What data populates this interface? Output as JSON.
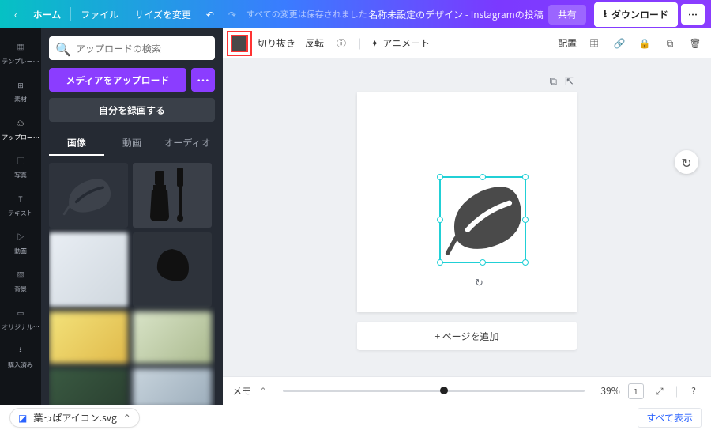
{
  "topbar": {
    "home": "ホーム",
    "file": "ファイル",
    "resize": "サイズを変更",
    "saved": "すべての変更は保存されました",
    "title": "名称未設定のデザイン - Instagramの投稿",
    "share": "共有",
    "download": "ダウンロード"
  },
  "rail": {
    "template": "テンプレー…",
    "elements": "素材",
    "upload": "アップロー…",
    "photo": "写真",
    "text": "テキスト",
    "video": "動画",
    "bg": "背景",
    "original": "オリジナル…",
    "purchased": "購入済み"
  },
  "panel": {
    "search_placeholder": "アップロードの検索",
    "upload": "メディアをアップロード",
    "record": "自分を録画する",
    "tabs": {
      "image": "画像",
      "video": "動画",
      "audio": "オーディオ"
    }
  },
  "context": {
    "crop": "切り抜き",
    "flip": "反転",
    "animate": "アニメート",
    "position": "配置"
  },
  "stage": {
    "add_page": "+ ページを追加"
  },
  "bottom": {
    "memo": "メモ",
    "zoom": "39%"
  },
  "download_bar": {
    "file": "葉っぱアイコン.svg",
    "show_all": "すべて表示"
  }
}
